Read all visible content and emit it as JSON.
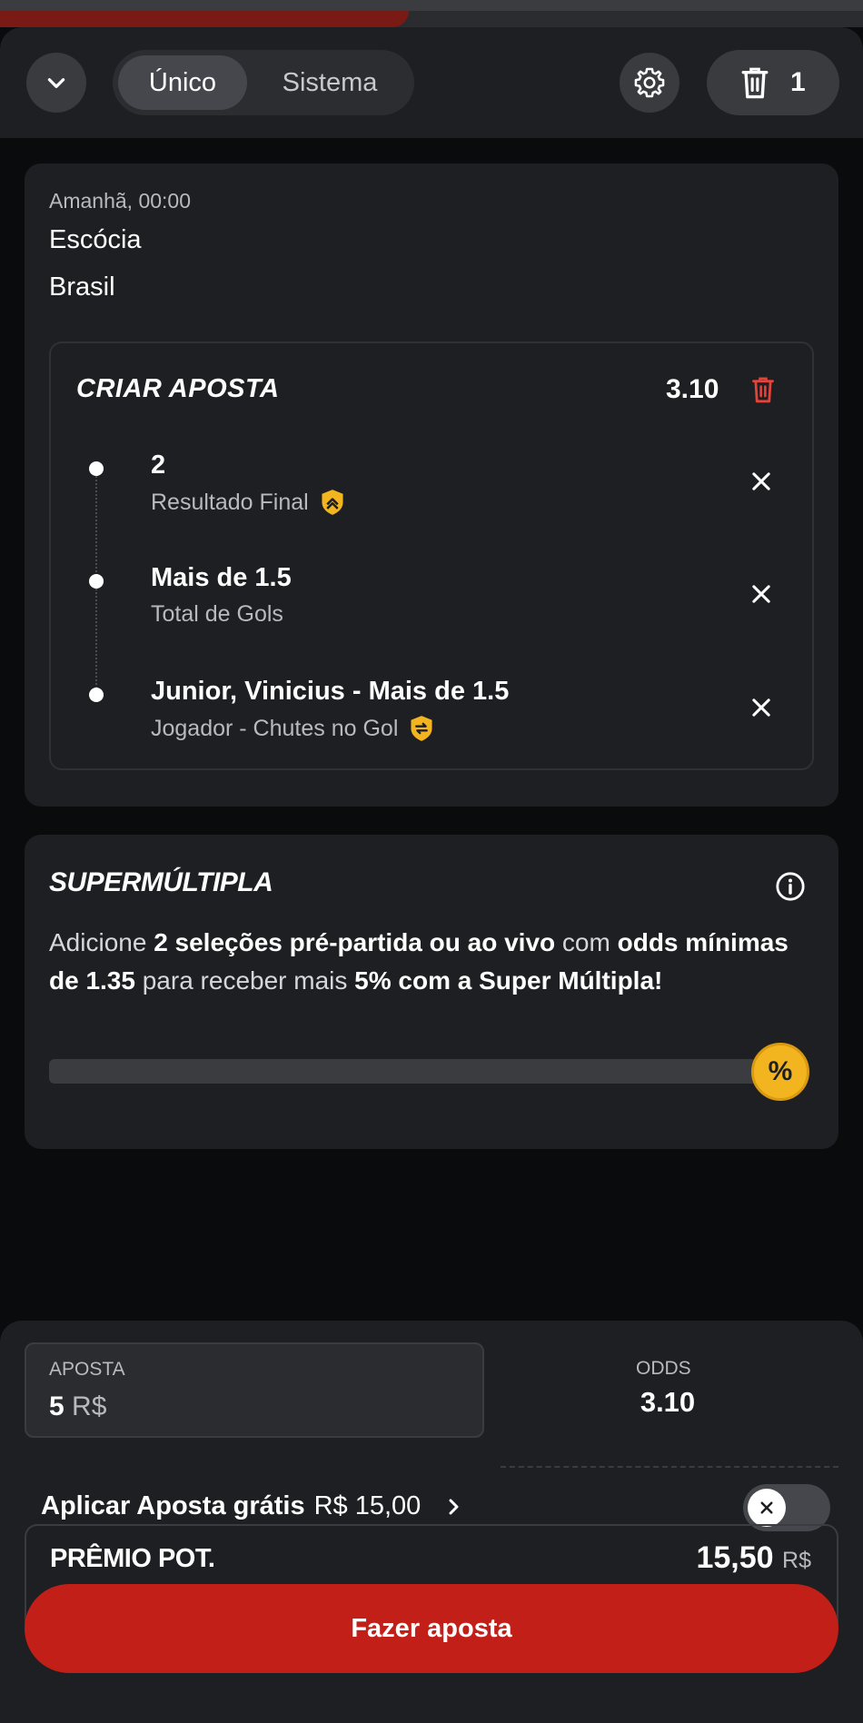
{
  "header": {
    "tab_unico": "Único",
    "tab_sistema": "Sistema",
    "selection_count": "1"
  },
  "event": {
    "time": "Amanhã, 00:00",
    "team_home": "Escócia",
    "team_away": "Brasil"
  },
  "bet_builder": {
    "title": "CRIAR APOSTA",
    "odds": "3.10",
    "selections": [
      {
        "title": "2",
        "market": "Resultado Final",
        "badge": "boost-chevron-icon"
      },
      {
        "title": "Mais de 1.5",
        "market": "Total de Gols",
        "badge": ""
      },
      {
        "title": "Junior, Vinicius - Mais de 1.5",
        "market": "Jogador - Chutes no Gol",
        "badge": "swap-badge-icon"
      }
    ]
  },
  "super_multipla": {
    "title": "SUPERMÚLTIPLA",
    "text_1": "Adicione ",
    "bold_1": "2 seleções pré-partida ou ao vivo",
    "text_2": " com ",
    "bold_2": "odds mínimas de 1.35",
    "text_3": " para receber mais ",
    "bold_3": "5% com a Super Múltipla!",
    "progress": 0.0,
    "badge_symbol": "%"
  },
  "betslip": {
    "stake_label": "APOSTA",
    "stake_value": "5",
    "stake_currency": "R$",
    "odds_label": "ODDS",
    "odds_value": "3.10",
    "free_bet_label": "Aplicar Aposta grátis",
    "free_bet_amount": "R$ 15,00",
    "free_bet_enabled": false,
    "prize_label": "PRÊMIO POT.",
    "prize_value": "15,50",
    "prize_currency": "R$",
    "submit_label": "Fazer aposta"
  },
  "colors": {
    "accent_red": "#c21f19",
    "delete_red": "#e0443a",
    "badge_yellow": "#f3b51f",
    "panel": "#1d1f22",
    "background": "#0a0b0d"
  }
}
